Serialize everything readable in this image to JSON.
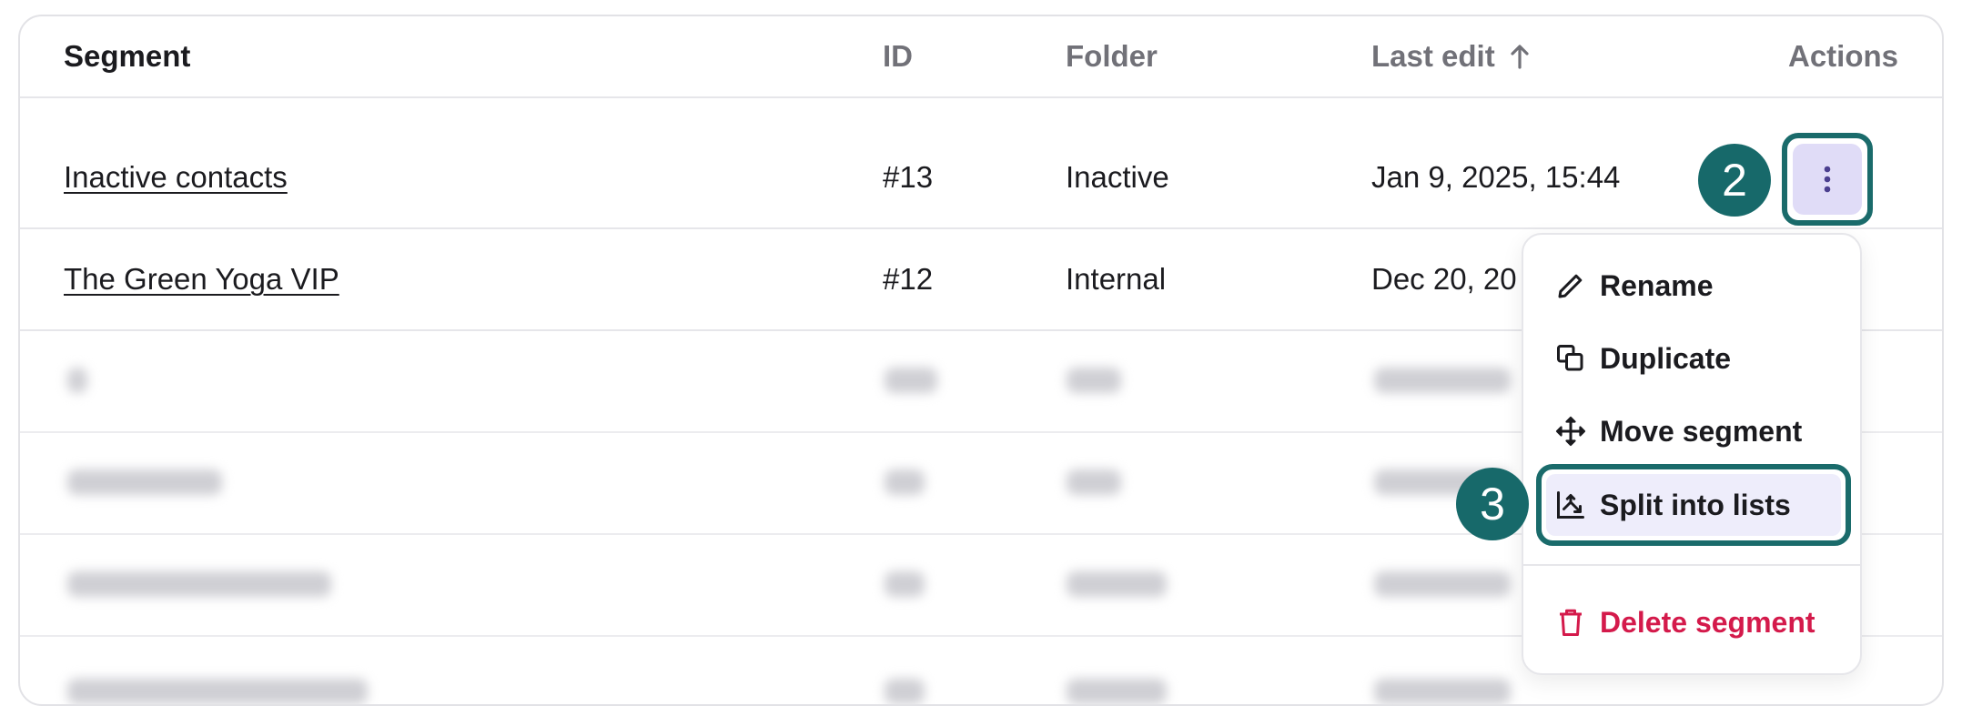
{
  "table": {
    "headers": {
      "segment": "Segment",
      "id": "ID",
      "folder": "Folder",
      "last_edit": "Last edit",
      "actions": "Actions"
    },
    "sort_icon": "arrow-up-icon",
    "rows": [
      {
        "segment": "Inactive contacts",
        "id": "#13",
        "folder": "Inactive",
        "last_edit": "Jan 9, 2025, 15:44"
      },
      {
        "segment": "The Green Yoga VIP",
        "id": "#12",
        "folder": "Internal",
        "last_edit": "Dec 20, 20"
      }
    ]
  },
  "actions_button": {
    "icon": "kebab-icon"
  },
  "annotations": {
    "step_actions": "2",
    "step_split": "3",
    "highlight_color": "#1a6b6b"
  },
  "menu": {
    "items": [
      {
        "label": "Rename",
        "icon": "pencil-icon"
      },
      {
        "label": "Duplicate",
        "icon": "duplicate-icon"
      },
      {
        "label": "Move segment",
        "icon": "move-icon"
      },
      {
        "label": "Split into lists",
        "icon": "split-icon"
      }
    ],
    "danger_item": {
      "label": "Delete segment",
      "icon": "trash-icon",
      "color": "#d41a4b"
    }
  }
}
